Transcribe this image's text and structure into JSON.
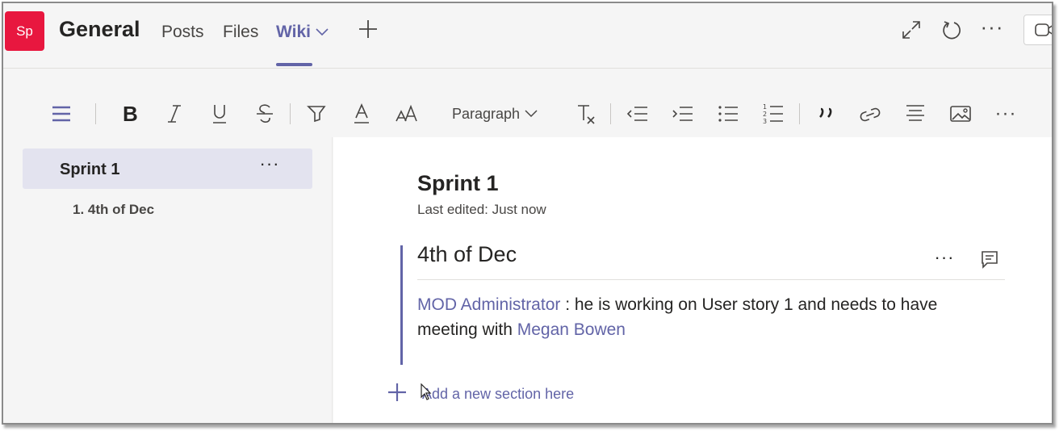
{
  "header": {
    "avatar_text": "Sp",
    "channel_title": "General",
    "tabs": [
      {
        "label": "Posts"
      },
      {
        "label": "Files"
      },
      {
        "label": "Wiki",
        "active": true
      }
    ],
    "icons": [
      "expand-icon",
      "refresh-icon",
      "more-options-icon",
      "meet-icon"
    ],
    "more_glyph": "···"
  },
  "toolbar": {
    "paragraph_label": "Paragraph",
    "items": [
      "menu-icon",
      "bold-icon",
      "italic-icon",
      "underline-icon",
      "strikethrough-icon",
      "highlight-icon",
      "font-color-icon",
      "font-size-icon",
      "clear-formatting-icon",
      "decrease-indent-icon",
      "increase-indent-icon",
      "bulleted-list-icon",
      "numbered-list-icon",
      "quote-icon",
      "link-icon",
      "align-icon",
      "image-icon",
      "more-icon"
    ]
  },
  "sidebar": {
    "selected_page": "Sprint 1",
    "more_glyph": "···",
    "sections": [
      {
        "label": "1. 4th of Dec"
      }
    ]
  },
  "main": {
    "page_title": "Sprint 1",
    "last_edited": "Last edited: Just now",
    "section": {
      "title": "4th of Dec",
      "more_glyph": "···",
      "mention_1": "MOD Administrator",
      "text_1": " : he is working on User story 1 and needs to have meeting with ",
      "mention_2": "Megan Bowen"
    },
    "add_section_label": "Add a new section here"
  },
  "colors": {
    "accent": "#6264a7",
    "avatar": "#e8173f",
    "background": "#f5f5f5"
  }
}
